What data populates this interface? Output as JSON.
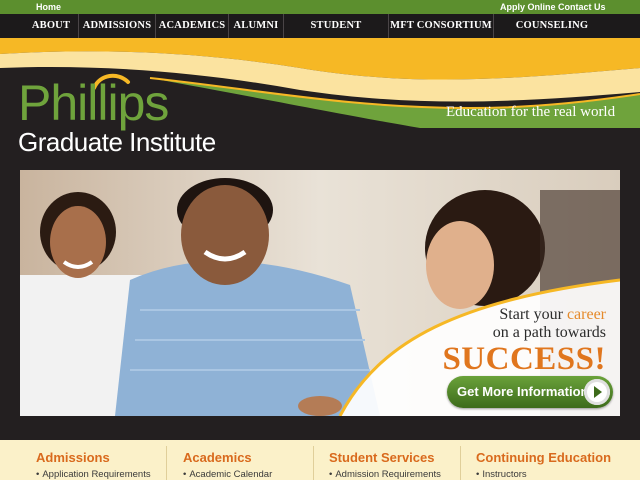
{
  "topbar": {
    "home": "Home",
    "apply_online": "Apply Online",
    "contact_us": "Contact Us"
  },
  "nav": {
    "items": [
      "ABOUT",
      "ADMISSIONS",
      "ACADEMICS",
      "ALUMNI",
      "STUDENT SERVICES",
      "MFT CONSORTIUM",
      "COUNSELING CENTER"
    ]
  },
  "header": {
    "logo_main": "Phillips",
    "logo_sub": "Graduate Institute",
    "tagline": "Education for the real world"
  },
  "hero": {
    "line1_prefix": "Start your ",
    "line1_accent": "career",
    "line2": "on a path towards",
    "success": "SUCCESS!",
    "cta_label": "Get More Information"
  },
  "columns": [
    {
      "title": "Admissions",
      "link": "Application Requirements"
    },
    {
      "title": "Academics",
      "link": "Academic Calendar"
    },
    {
      "title": "Student Services",
      "link": "Admission Requirements"
    },
    {
      "title": "Continuing Education",
      "link": "Instructors"
    }
  ],
  "colors": {
    "brand_green": "#6fa33c",
    "topbar_green": "#5c8f2e",
    "accent_orange": "#e0761e",
    "header_yellow": "#f6b825",
    "background_dark": "#231f20",
    "footer_cream": "#fbf1c9"
  }
}
